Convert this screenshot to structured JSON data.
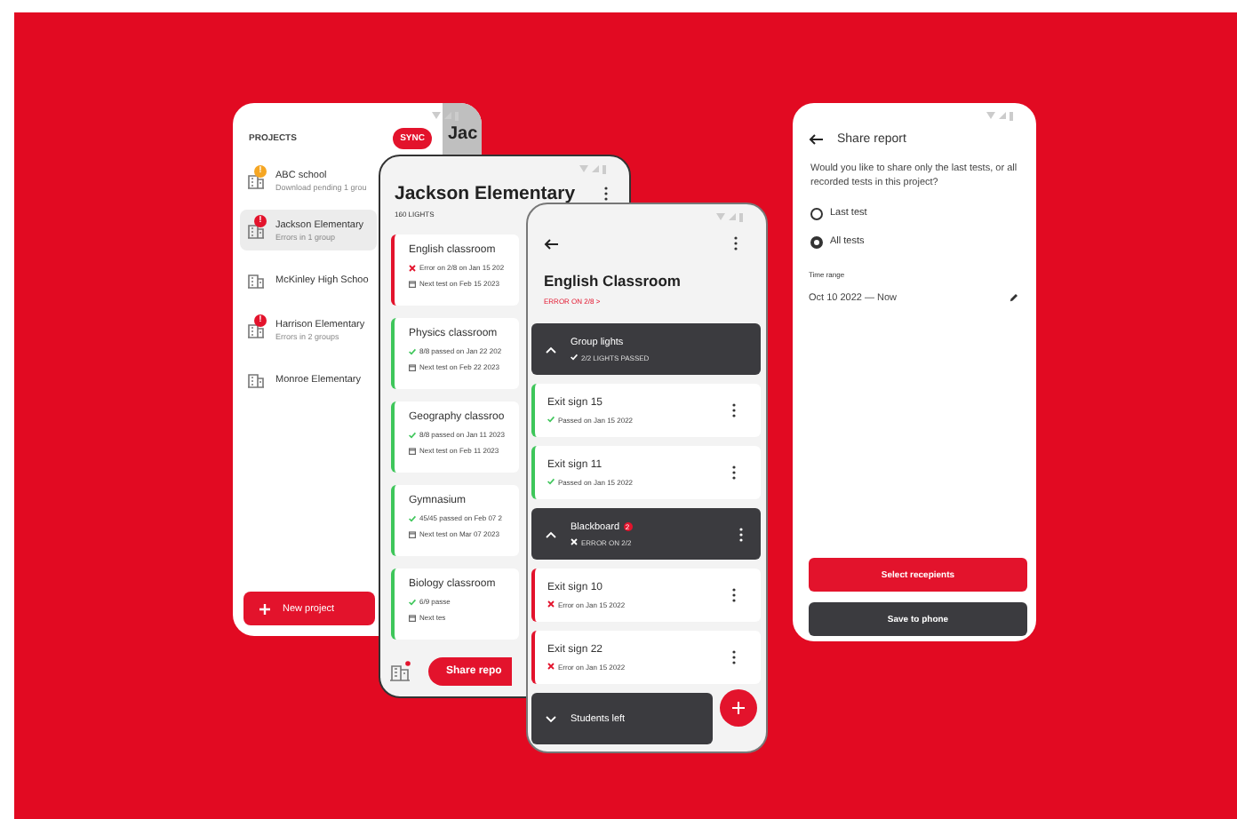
{
  "projects_screen": {
    "heading": "PROJECTS",
    "sync_button": "SYNC",
    "peek_title": "Jac",
    "projects": [
      {
        "name": "ABC school",
        "status": "Download pending 1 grou",
        "badge": "!",
        "color": "#f5a623",
        "selected": false
      },
      {
        "name": "Jackson Elementary",
        "status": "Errors in 1 group",
        "badge": "!",
        "color": "#e3132c",
        "selected": true
      },
      {
        "name": "McKinley High Schoo",
        "selected": false
      },
      {
        "name": "Harrison Elementary",
        "status": "Errors in 2 groups",
        "badge": "!",
        "color": "#e3132c",
        "selected": false
      },
      {
        "name": "Monroe Elementary",
        "selected": false
      }
    ],
    "new_project_button": "New project"
  },
  "project_screen": {
    "title": "Jackson Elementary",
    "subtitle": "160 LIGHTS",
    "rooms": [
      {
        "name": "English classroom",
        "failed": true,
        "result": "Error on 2/8 on Jan 15 202",
        "next_test": "Next test on Feb 15 2023"
      },
      {
        "name": "Physics classroom",
        "failed": false,
        "result": "8/8 passed on Jan 22 202",
        "next_test": "Next test on Feb 22 2023"
      },
      {
        "name": "Geography classroo",
        "failed": false,
        "result": "8/8 passed on Jan 11 2023",
        "next_test": "Next test on Feb 11 2023"
      },
      {
        "name": "Gymnasium",
        "failed": false,
        "result": "45/45 passed on Feb 07 2",
        "next_test": "Next test on Mar 07 2023"
      },
      {
        "name": "Biology classroom",
        "failed": false,
        "result": "6/9 passe",
        "next_test": "Next tes"
      }
    ],
    "share_button": "Share repo"
  },
  "room_screen": {
    "title": "English Classroom",
    "error_link": "ERROR ON 2/8 >",
    "groups": [
      {
        "name": "Group lights",
        "failed": false,
        "summary": "2/2 LIGHTS PASSED",
        "expanded": true,
        "lights": [
          {
            "name": "Exit sign 15",
            "failed": false,
            "result": "Passed on Jan 15 2022"
          },
          {
            "name": "Exit sign 11",
            "failed": false,
            "result": "Passed on Jan 15 2022"
          }
        ]
      },
      {
        "name": "Blackboard",
        "badge": "2",
        "failed": true,
        "summary": "ERROR ON 2/2",
        "expanded": true,
        "lights": [
          {
            "name": "Exit sign 10",
            "failed": true,
            "result": "Error on Jan 15 2022"
          },
          {
            "name": "Exit sign 22",
            "failed": true,
            "result": "Error on Jan 15 2022"
          }
        ]
      },
      {
        "name": "Students left",
        "expanded": false
      }
    ]
  },
  "share_screen": {
    "title": "Share report",
    "question": "Would you like to share only the last tests, or all recorded tests in this project?",
    "options": [
      {
        "label": "Last test",
        "selected": false
      },
      {
        "label": "All tests",
        "selected": true
      }
    ],
    "time_range_label": "Time range",
    "time_range": "Oct 10 2022 — Now",
    "primary_button": "Select recepients",
    "secondary_button": "Save to phone"
  }
}
